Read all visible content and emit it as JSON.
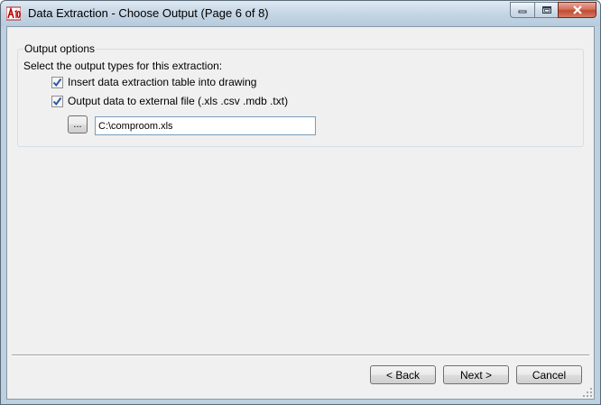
{
  "window": {
    "title": "Data Extraction - Choose Output (Page 6 of 8)",
    "app_icon_text": "A10"
  },
  "output_options": {
    "group_title": "Output options",
    "description": "Select the output types for this extraction:",
    "insert_table": {
      "label": "Insert data extraction table into drawing",
      "checked": true
    },
    "external_file": {
      "label": "Output data to external file (.xls .csv .mdb .txt)",
      "checked": true
    },
    "browse_label": "...",
    "file_path": "C:\\comproom.xls"
  },
  "footer": {
    "back_label": "< Back",
    "next_label": "Next >",
    "cancel_label": "Cancel"
  },
  "colors": {
    "title_bar": "#c5d6e5",
    "close_button": "#c14a34",
    "dialog_background": "#f0f0f0"
  }
}
